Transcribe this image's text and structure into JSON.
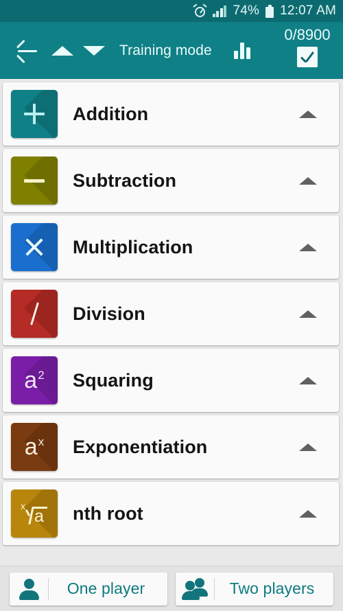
{
  "status_bar": {
    "alarm_icon": "alarm-clock-icon",
    "signal_icon": "signal-bars-icon",
    "battery_percent": "74%",
    "battery_icon": "battery-icon",
    "time": "12:07 AM"
  },
  "toolbar": {
    "back_icon": "back-arrow-icon",
    "up_icon": "triangle-up-icon",
    "down_icon": "triangle-down-icon",
    "title": "Training mode",
    "stats_icon": "bar-chart-icon",
    "progress_count": "0/8900",
    "select_all_checked": true,
    "background": "#0f8086"
  },
  "operations": [
    {
      "label": "Addition",
      "symbol": "+",
      "tile_color": "#0f8086",
      "glyph_color": "#b9f0f0",
      "expand_icon": "chevron-up-icon"
    },
    {
      "label": "Subtraction",
      "symbol": "−",
      "tile_color": "#808000",
      "glyph_color": "#f4f2c4",
      "expand_icon": "chevron-up-icon"
    },
    {
      "label": "Multiplication",
      "symbol": "×",
      "tile_color": "#1a6fce",
      "glyph_color": "#eafbff",
      "expand_icon": "chevron-up-icon"
    },
    {
      "label": "Division",
      "symbol": "/",
      "tile_color": "#b52b25",
      "glyph_color": "#f6ece6",
      "expand_icon": "chevron-up-icon"
    },
    {
      "label": "Squaring",
      "symbol": "a²",
      "base": "a",
      "exponent": "2",
      "tile_color": "#7a1ea8",
      "glyph_color": "#f3e3f8",
      "expand_icon": "chevron-up-icon"
    },
    {
      "label": "Exponentiation",
      "symbol": "aˣ",
      "base": "a",
      "exponent": "x",
      "tile_color": "#7a3b10",
      "glyph_color": "#fbeedd",
      "expand_icon": "chevron-up-icon"
    },
    {
      "label": "nth root",
      "symbol": "ˣ√a",
      "base": "a",
      "exponent": "x",
      "tile_color": "#b8860b",
      "glyph_color": "#fdf3d2",
      "expand_icon": "chevron-up-icon"
    }
  ],
  "bottom_bar": {
    "one_player": {
      "label": "One player",
      "icon": "person-icon"
    },
    "two_players": {
      "label": "Two players",
      "icon": "people-icon"
    },
    "accent_color": "#0d7a7f"
  }
}
